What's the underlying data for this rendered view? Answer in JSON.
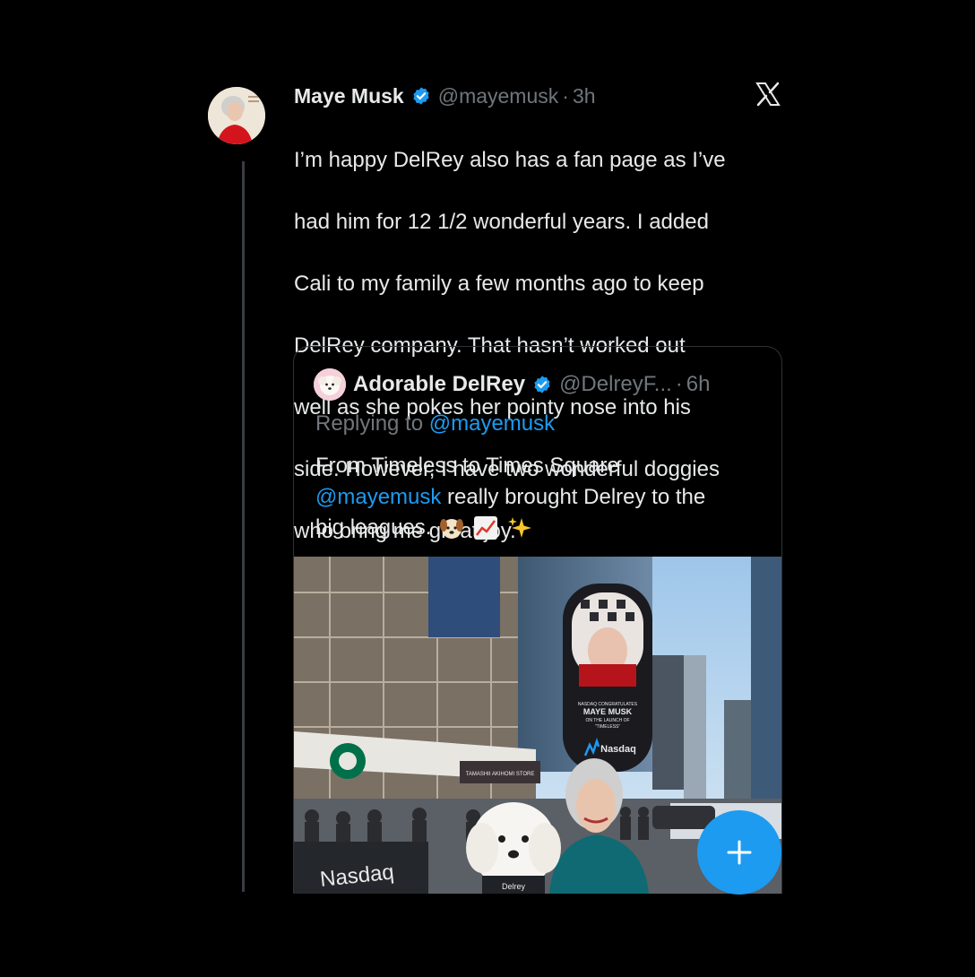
{
  "tweet": {
    "author_name": "Maye Musk",
    "handle": "@mayemusk",
    "separator": "·",
    "time": "3h",
    "text_lines": [
      "I’m happy DelRey also has a fan page as I’ve",
      "had him for 12 1/2 wonderful years. I added",
      "Cali to my family a few months ago to keep",
      "DelRey company. That hasn’t worked out",
      "well as she pokes her pointy nose into his",
      "side. However, I have two wonderful doggies",
      "who bring me great joy."
    ]
  },
  "quote": {
    "author_name": "Adorable DelRey",
    "handle": "@DelreyF...",
    "separator": "·",
    "time": "6h",
    "replying_prefix": "Replying to",
    "replying_handle": "@mayemusk",
    "line1": "From Timeless to Times Square",
    "mention": "@mayemusk",
    "line2_rest": " really brought Delrey to the",
    "line3": "big leagues.",
    "emojis": [
      "dog-face",
      "chart-increasing",
      "sparkles"
    ]
  },
  "photo": {
    "billboard_lines": [
      "NASDAQ CONGRATULATES",
      "MAYE MUSK",
      "ON THE LAUNCH OF",
      "\"TIMELESS\""
    ],
    "billboard_brand": "Nasdaq",
    "barrier_brand": "Nasdaq",
    "store_sign": "TAMASHII AKIHOMI STORE",
    "dog_tag": "Delrey"
  },
  "icons": {
    "verified": "verified-badge-icon",
    "x_logo": "x-logo-icon",
    "compose": "plus-icon"
  },
  "colors": {
    "background": "#000000",
    "text": "#e7e9ea",
    "muted": "#71767b",
    "accent": "#1d9bf0"
  }
}
